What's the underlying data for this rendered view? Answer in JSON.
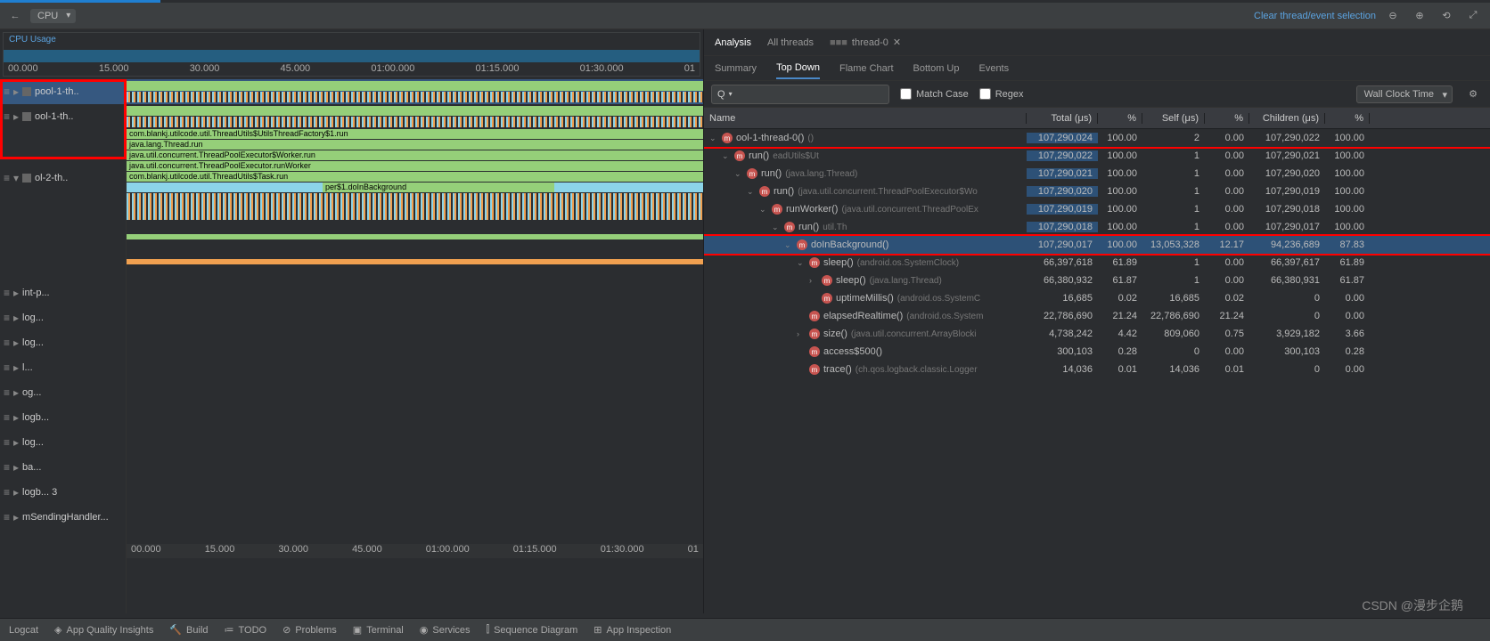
{
  "toolbar": {
    "back": "←",
    "dropdown": "CPU",
    "clear_link": "Clear thread/event selection"
  },
  "cpu": {
    "label": "CPU Usage",
    "ticks": [
      "00.000",
      "15.000",
      "30.000",
      "45.000",
      "01:00.000",
      "01:15.000",
      "01:30.000",
      "01"
    ]
  },
  "threads": [
    {
      "lbl": "pool-1-th..",
      "sel": true
    },
    {
      "lbl": "ool-1-th..",
      "sel": false
    },
    {
      "lbl": "ol-2-th..",
      "sel": false
    }
  ],
  "other_threads": [
    "int-p...",
    "log...",
    "log...",
    "l...",
    "og...",
    "logb...",
    "log...",
    "ba...",
    "logb... 3",
    "mSendingHandler..."
  ],
  "stack_labels": [
    "com.blankj.utilcode.util.ThreadUtils$UtilsThreadFactory$1.run",
    "java.lang.Thread.run",
    "java.util.concurrent.ThreadPoolExecutor$Worker.run",
    "java.util.concurrent.ThreadPoolExecutor.runWorker",
    "com.blankj.utilcode.util.ThreadUtils$Task.run",
    "per$1.doInBackground"
  ],
  "rtabs": {
    "analysis": "Analysis",
    "all": "All threads",
    "th": "thread-0"
  },
  "rtabs2": [
    "Summary",
    "Top Down",
    "Flame Chart",
    "Bottom Up",
    "Events"
  ],
  "filters": {
    "search": "Q",
    "match": "Match Case",
    "regex": "Regex",
    "metric": "Wall Clock Time"
  },
  "cols": [
    "Name",
    "Total (μs)",
    "%",
    "Self (μs)",
    "%",
    "Children (μs)",
    "%"
  ],
  "rows": [
    {
      "d": 0,
      "exp": "v",
      "name": "ool-1-thread-0()",
      "pkg": "()",
      "total": "107,290,024",
      "p1": "100.00",
      "self": "2",
      "p2": "0.00",
      "ch": "107,290,022",
      "p3": "100.00",
      "hl": true,
      "red": true
    },
    {
      "d": 1,
      "exp": "v",
      "name": "run()",
      "pkg": "eadUtils$Ut",
      "total": "107,290,022",
      "p1": "100.00",
      "self": "1",
      "p2": "0.00",
      "ch": "107,290,021",
      "p3": "100.00",
      "hl": true
    },
    {
      "d": 2,
      "exp": "v",
      "name": "run()",
      "pkg": "(java.lang.Thread)",
      "total": "107,290,021",
      "p1": "100.00",
      "self": "1",
      "p2": "0.00",
      "ch": "107,290,020",
      "p3": "100.00",
      "hl": true
    },
    {
      "d": 3,
      "exp": "v",
      "name": "run()",
      "pkg": "(java.util.concurrent.ThreadPoolExecutor$Wo",
      "total": "107,290,020",
      "p1": "100.00",
      "self": "1",
      "p2": "0.00",
      "ch": "107,290,019",
      "p3": "100.00",
      "hl": true
    },
    {
      "d": 4,
      "exp": "v",
      "name": "runWorker()",
      "pkg": "(java.util.concurrent.ThreadPoolEx",
      "total": "107,290,019",
      "p1": "100.00",
      "self": "1",
      "p2": "0.00",
      "ch": "107,290,018",
      "p3": "100.00",
      "hl": true
    },
    {
      "d": 5,
      "exp": "v",
      "name": "run()",
      "pkg": "util.Th",
      "total": "107,290,018",
      "p1": "100.00",
      "self": "1",
      "p2": "0.00",
      "ch": "107,290,017",
      "p3": "100.00",
      "hl": true
    },
    {
      "d": 6,
      "exp": "v",
      "name": "doInBackground()",
      "pkg": "",
      "total": "107,290,017",
      "p1": "100.00",
      "self": "13,053,328",
      "p2": "12.17",
      "ch": "94,236,689",
      "p3": "87.83",
      "hl": true,
      "sel": true,
      "red": true
    },
    {
      "d": 7,
      "exp": "v",
      "name": "sleep()",
      "pkg": "(android.os.SystemClock)",
      "total": "66,397,618",
      "p1": "61.89",
      "self": "1",
      "p2": "0.00",
      "ch": "66,397,617",
      "p3": "61.89"
    },
    {
      "d": 8,
      "exp": ">",
      "name": "sleep()",
      "pkg": "(java.lang.Thread)",
      "total": "66,380,932",
      "p1": "61.87",
      "self": "1",
      "p2": "0.00",
      "ch": "66,380,931",
      "p3": "61.87"
    },
    {
      "d": 8,
      "exp": "",
      "name": "uptimeMillis()",
      "pkg": "(android.os.SystemC",
      "total": "16,685",
      "p1": "0.02",
      "self": "16,685",
      "p2": "0.02",
      "ch": "0",
      "p3": "0.00"
    },
    {
      "d": 7,
      "exp": "",
      "name": "elapsedRealtime()",
      "pkg": "(android.os.System",
      "total": "22,786,690",
      "p1": "21.24",
      "self": "22,786,690",
      "p2": "21.24",
      "ch": "0",
      "p3": "0.00"
    },
    {
      "d": 7,
      "exp": ">",
      "name": "size()",
      "pkg": "(java.util.concurrent.ArrayBlocki",
      "total": "4,738,242",
      "p1": "4.42",
      "self": "809,060",
      "p2": "0.75",
      "ch": "3,929,182",
      "p3": "3.66"
    },
    {
      "d": 7,
      "exp": "",
      "name": "access$500()",
      "pkg": "",
      "total": "300,103",
      "p1": "0.28",
      "self": "0",
      "p2": "0.00",
      "ch": "300,103",
      "p3": "0.28"
    },
    {
      "d": 7,
      "exp": "",
      "name": "trace()",
      "pkg": "(ch.qos.logback.classic.Logger",
      "total": "14,036",
      "p1": "0.01",
      "self": "14,036",
      "p2": "0.01",
      "ch": "0",
      "p3": "0.00"
    }
  ],
  "bottom": [
    "Logcat",
    "App Quality Insights",
    "Build",
    "TODO",
    "Problems",
    "Terminal",
    "Services",
    "Sequence Diagram",
    "App Inspection"
  ],
  "watermark": "CSDN @漫步企鹅"
}
